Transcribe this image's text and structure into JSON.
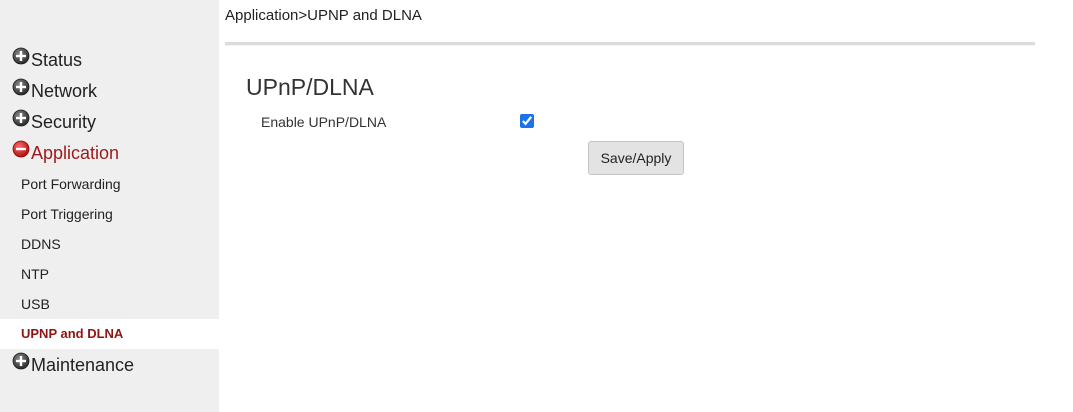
{
  "breadcrumb": "Application>UPNP and DLNA",
  "sidebar": {
    "status_label": "Status",
    "network_label": "Network",
    "security_label": "Security",
    "application_label": "Application",
    "application_items": [
      {
        "label": "Port Forwarding"
      },
      {
        "label": "Port Triggering"
      },
      {
        "label": "DDNS"
      },
      {
        "label": "NTP"
      },
      {
        "label": "USB"
      },
      {
        "label": "UPNP and DLNA"
      }
    ],
    "maintenance_label": "Maintenance"
  },
  "main": {
    "section_title": "UPnP/DLNA",
    "enable_label": "Enable UPnP/DLNA",
    "enable_checked": true,
    "save_label": "Save/Apply"
  },
  "colors": {
    "active_menu": "#9b1b1b",
    "sidebar_bg": "#efefef",
    "plus_icon": "#3a3a3a",
    "minus_icon": "#d32020"
  },
  "icons": {
    "collapsed": "plus-circle-icon",
    "expanded": "minus-circle-icon"
  }
}
